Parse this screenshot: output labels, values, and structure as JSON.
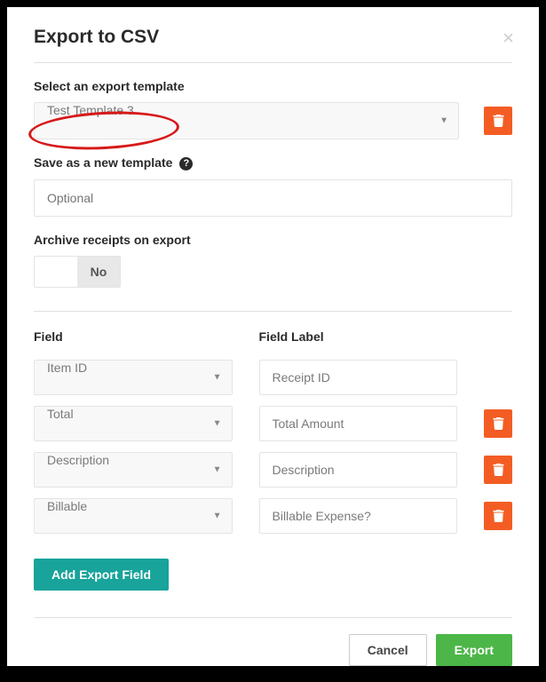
{
  "modal": {
    "title": "Export to CSV",
    "close": "×",
    "template": {
      "label": "Select an export template",
      "selected": "Test Template 3"
    },
    "saveAs": {
      "label": "Save as a new template",
      "placeholder": "Optional"
    },
    "archive": {
      "label": "Archive receipts on export",
      "no": "No"
    },
    "fieldsHeader": {
      "field": "Field",
      "fieldLabel": "Field Label"
    },
    "fields": [
      {
        "field": "Item ID",
        "label": "Receipt ID",
        "deletable": false
      },
      {
        "field": "Total",
        "label": "Total Amount",
        "deletable": true
      },
      {
        "field": "Description",
        "label": "Description",
        "deletable": true
      },
      {
        "field": "Billable",
        "label": "Billable Expense?",
        "deletable": true
      }
    ],
    "addField": "Add Export Field",
    "cancel": "Cancel",
    "export": "Export"
  }
}
